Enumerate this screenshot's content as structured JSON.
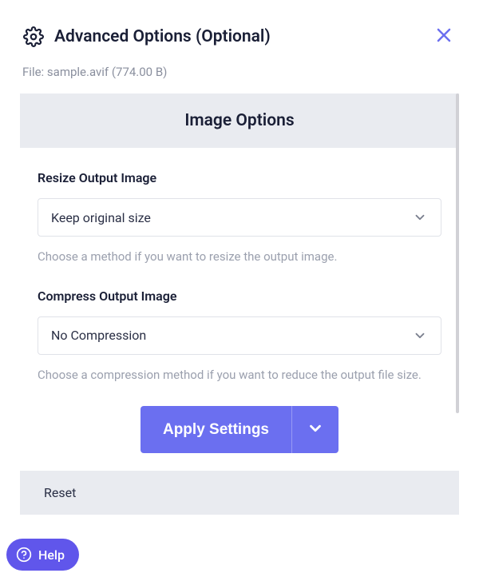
{
  "header": {
    "title": "Advanced Options (Optional)"
  },
  "file": {
    "label": "File:",
    "name": "sample.avif",
    "size": "(774.00 B)"
  },
  "section": {
    "title": "Image Options"
  },
  "resize": {
    "label": "Resize Output Image",
    "value": "Keep original size",
    "hint": "Choose a method if you want to resize the output image."
  },
  "compress": {
    "label": "Compress Output Image",
    "value": "No Compression",
    "hint": "Choose a compression method if you want to reduce the output file size."
  },
  "footer": {
    "apply": "Apply Settings",
    "reset": "Reset"
  },
  "help": {
    "label": "Help"
  }
}
